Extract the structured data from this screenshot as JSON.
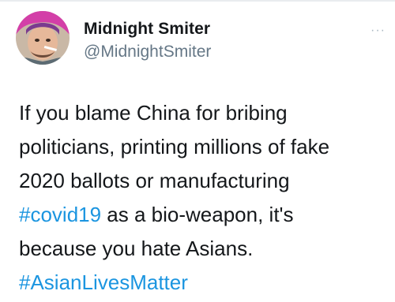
{
  "tweet": {
    "display_name": "Midnight Smiter",
    "handle": "@MidnightSmiter",
    "more_icon": "···",
    "lines": [
      [
        "If you blame China for bribing"
      ],
      [
        "politicians, printing millions of fake"
      ],
      [
        "2020 ballots or manufacturing"
      ],
      [
        "as a bio-weapon, it's"
      ],
      [
        "because you hate Asians."
      ]
    ],
    "hashtag_covid": "#covid19",
    "line4_rest": " as a bio-weapon, it's",
    "hashtag_asian": "#AsianLivesMatter",
    "colors": {
      "hashtag": "#1b95e0",
      "handle": "#657786",
      "text": "#14171a"
    }
  }
}
